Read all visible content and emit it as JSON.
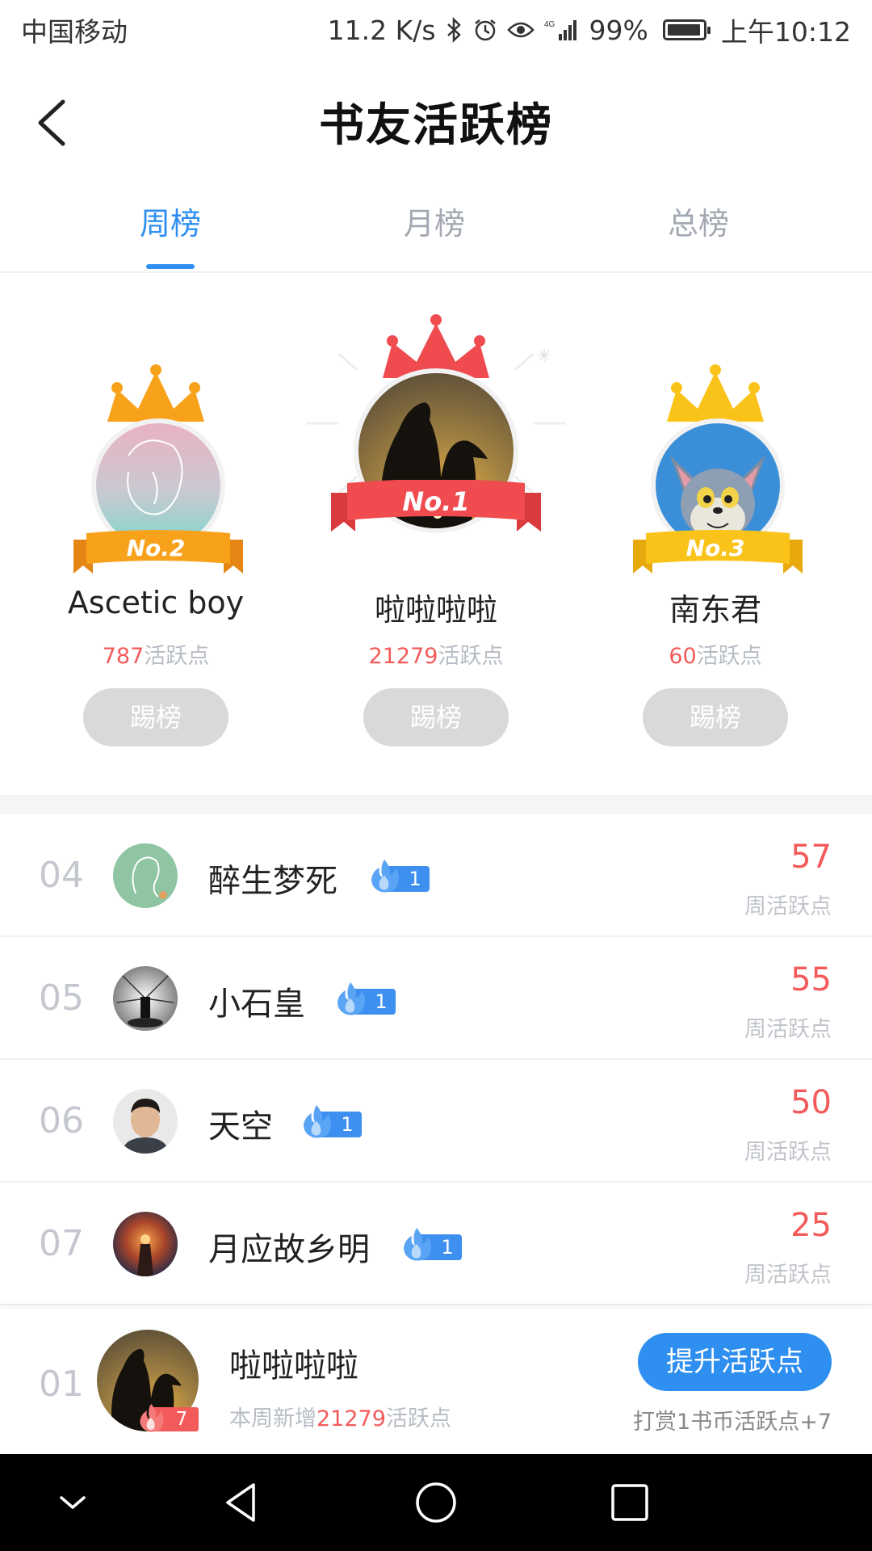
{
  "status_bar": {
    "carrier": "中国移动",
    "speed": "11.2 K/s",
    "battery": "99%",
    "time": "上午10:12",
    "icons": [
      "bluetooth-icon",
      "alarm-icon",
      "eye-icon",
      "signal-icon",
      "battery-icon"
    ]
  },
  "header": {
    "title": "书友活跃榜"
  },
  "tabs": [
    {
      "label": "周榜",
      "active": true
    },
    {
      "label": "月榜",
      "active": false
    },
    {
      "label": "总榜",
      "active": false
    }
  ],
  "podium": {
    "second": {
      "rank": "No.2",
      "name": "Ascetic boy",
      "points": "787",
      "points_label": "活跃点",
      "button": "踢榜"
    },
    "first": {
      "rank": "No.1",
      "name": "啦啦啦啦",
      "points": "21279",
      "points_label": "活跃点",
      "button": "踢榜"
    },
    "third": {
      "rank": "No.3",
      "name": "南东君",
      "points": "60",
      "points_label": "活跃点",
      "button": "踢榜"
    }
  },
  "list": [
    {
      "rank": "04",
      "name": "醉生梦死",
      "level": "1",
      "points": "57",
      "points_label": "周活跃点"
    },
    {
      "rank": "05",
      "name": "小石皇",
      "level": "1",
      "points": "55",
      "points_label": "周活跃点"
    },
    {
      "rank": "06",
      "name": "天空",
      "level": "1",
      "points": "50",
      "points_label": "周活跃点"
    },
    {
      "rank": "07",
      "name": "月应故乡明",
      "level": "1",
      "points": "25",
      "points_label": "周活跃点"
    }
  ],
  "me": {
    "rank": "01",
    "name": "啦啦啦啦",
    "level": "7",
    "summary_prefix": "本周新增",
    "summary_points": "21279",
    "summary_suffix": "活跃点",
    "button": "提升活跃点",
    "hint": "打赏1书币活跃点+7"
  },
  "colors": {
    "accent": "#2e8ff0",
    "points_red": "#f35b5b",
    "crown_gold": "#f8a21c",
    "crown_red": "#f04b4f"
  }
}
